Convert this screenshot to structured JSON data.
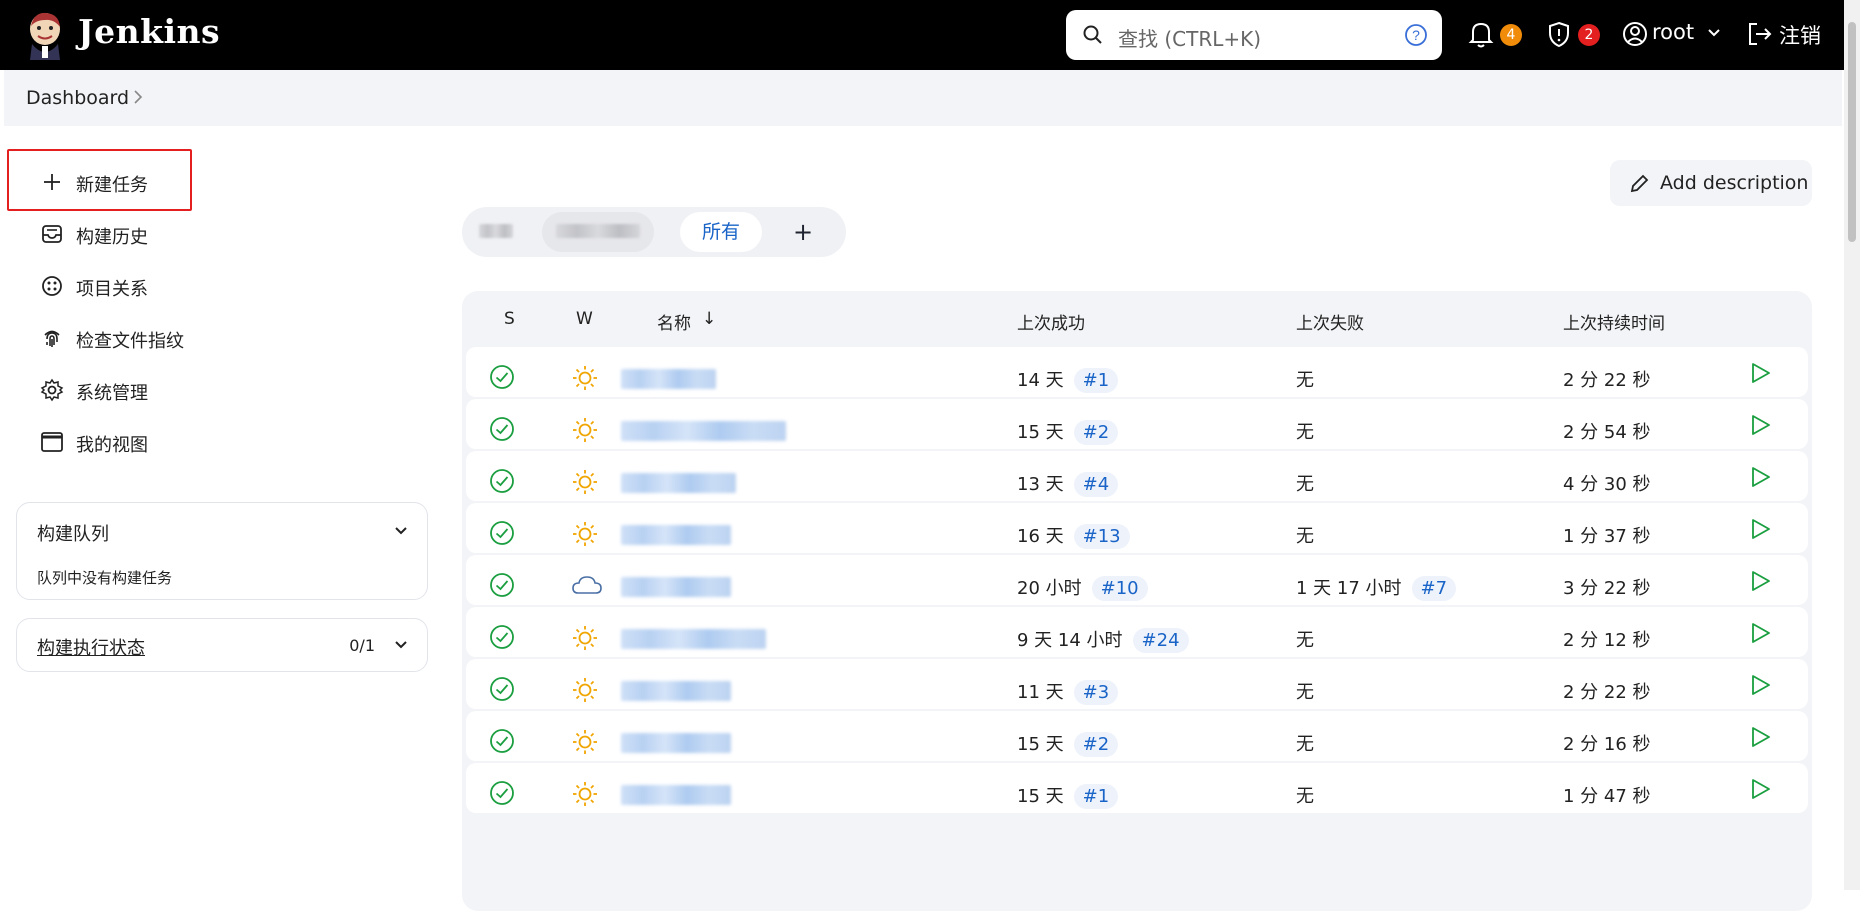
{
  "header": {
    "brand": "Jenkins",
    "search_placeholder": "查找 (CTRL+K)",
    "notifications_count": "4",
    "security_count": "2",
    "user": "root",
    "logout": "注销",
    "colors": {
      "bg": "#000000",
      "notif_badge": "#f08c0a",
      "security_badge": "#e41f1f"
    }
  },
  "breadcrumb": {
    "items": [
      "Dashboard"
    ]
  },
  "sidebar": {
    "tasks": [
      {
        "label": "新建任务",
        "icon": "plus-icon"
      },
      {
        "label": "构建历史",
        "icon": "inbox-icon"
      },
      {
        "label": "项目关系",
        "icon": "relationship-icon"
      },
      {
        "label": "检查文件指纹",
        "icon": "fingerprint-icon"
      },
      {
        "label": "系统管理",
        "icon": "gear-icon"
      },
      {
        "label": "我的视图",
        "icon": "window-icon"
      }
    ],
    "build_queue": {
      "title": "构建队列",
      "empty": "队列中没有构建任务"
    },
    "executors": {
      "title": "构建执行状态",
      "count": "0/1"
    }
  },
  "main": {
    "add_description": "Add description",
    "tabs": {
      "active": "所有",
      "add": "+"
    },
    "table": {
      "headers": {
        "s": "S",
        "w": "W",
        "name": "名称",
        "sort": "↓",
        "last_success": "上次成功",
        "last_failure": "上次失败",
        "last_duration": "上次持续时间"
      },
      "rows": [
        {
          "weather": "sunny",
          "last_success": "14 天",
          "success_build": "#1",
          "last_failure": "无",
          "failure_build": "",
          "duration": "2 分 22 秒"
        },
        {
          "weather": "sunny",
          "last_success": "15 天",
          "success_build": "#2",
          "last_failure": "无",
          "failure_build": "",
          "duration": "2 分 54 秒"
        },
        {
          "weather": "sunny",
          "last_success": "13 天",
          "success_build": "#4",
          "last_failure": "无",
          "failure_build": "",
          "duration": "4 分 30 秒"
        },
        {
          "weather": "sunny",
          "last_success": "16 天",
          "success_build": "#13",
          "last_failure": "无",
          "failure_build": "",
          "duration": "1 分 37 秒"
        },
        {
          "weather": "cloudy",
          "last_success": "20 小时",
          "success_build": "#10",
          "last_failure": "1 天 17 小时",
          "failure_build": "#7",
          "duration": "3 分 22 秒"
        },
        {
          "weather": "sunny",
          "last_success": "9 天 14 小时",
          "success_build": "#24",
          "last_failure": "无",
          "failure_build": "",
          "duration": "2 分 12 秒"
        },
        {
          "weather": "sunny",
          "last_success": "11 天",
          "success_build": "#3",
          "last_failure": "无",
          "failure_build": "",
          "duration": "2 分 22 秒"
        },
        {
          "weather": "sunny",
          "last_success": "15 天",
          "success_build": "#2",
          "last_failure": "无",
          "failure_build": "",
          "duration": "2 分 16 秒"
        },
        {
          "weather": "sunny",
          "last_success": "15 天",
          "success_build": "#1",
          "last_failure": "无",
          "failure_build": "",
          "duration": "1 分 47 秒"
        }
      ]
    }
  }
}
